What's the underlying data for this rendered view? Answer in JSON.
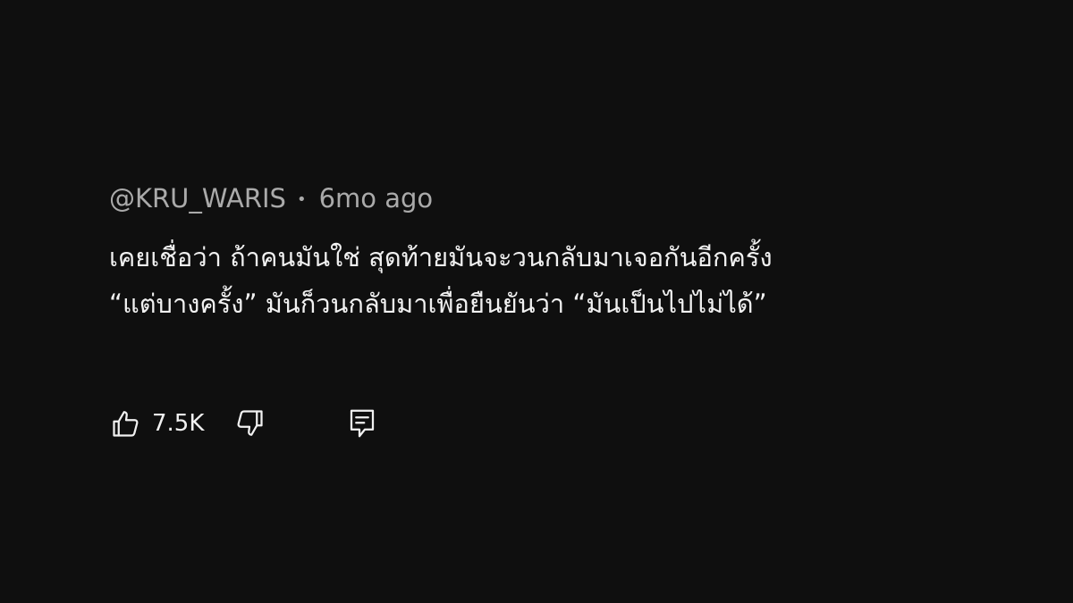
{
  "comment": {
    "author": "@KRU_WARIS",
    "separator": "•",
    "timestamp": "6mo ago",
    "text_lines": [
      "เคยเชื่อว่า ถ้าคนมันใช่ สุดท้ายมันจะวนกลับมาเจอกันอีกครั้ง",
      "“แต่บางครั้ง” มันก็วนกลับมาเพื่อยืนยันว่า “มันเป็นไปไม่ได้”"
    ]
  },
  "actions": {
    "like_icon": "thumbs-up-icon",
    "like_count": "7.5K",
    "dislike_icon": "thumbs-down-icon",
    "reply_icon": "reply-comment-icon"
  },
  "colors": {
    "background": "#0f0f0f",
    "primary_text": "#f1f1f1",
    "secondary_text": "#aaaaaa"
  }
}
